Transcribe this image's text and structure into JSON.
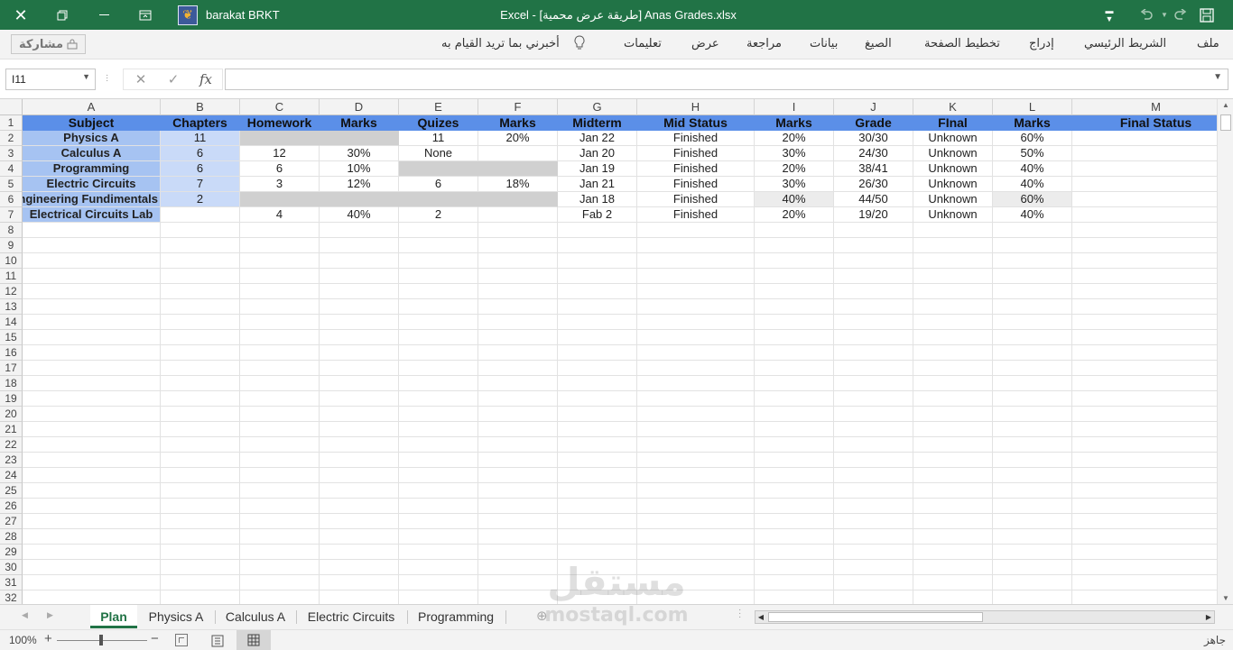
{
  "titlebar": {
    "user_name": "barakat BRKT",
    "title": "Excel  -  [طريقة عرض محمية]  Anas Grades.xlsx",
    "bg_color": "#217346"
  },
  "ribbon": {
    "share_label": "مشاركة",
    "tell_me": "أخبرني بما تريد القيام به",
    "tabs": [
      "ملف",
      "الشريط الرئيسي",
      "إدراج",
      "تخطيط الصفحة",
      "الصيغ",
      "بيانات",
      "مراجعة",
      "عرض",
      "تعليمات"
    ]
  },
  "formula_bar": {
    "name_box": "I11",
    "formula": ""
  },
  "columns": [
    "A",
    "B",
    "C",
    "D",
    "E",
    "F",
    "G",
    "H",
    "I",
    "J",
    "K",
    "L",
    "M"
  ],
  "rows_count": 32,
  "header_row": [
    "Subject",
    "Chapters",
    "Homework",
    "Marks",
    "Quizes",
    "Marks",
    "Midterm",
    "Mid Status",
    "Marks",
    "Grade",
    "FInal",
    "Marks",
    "Final Status"
  ],
  "data_rows": [
    [
      "Physics A",
      "11",
      "",
      "",
      "11",
      "20%",
      "Jan 22",
      "Finished",
      "20%",
      "30/30",
      "Unknown",
      "60%",
      ""
    ],
    [
      "Calculus A",
      "6",
      "12",
      "30%",
      "None",
      "",
      "Jan 20",
      "Finished",
      "30%",
      "24/30",
      "Unknown",
      "50%",
      ""
    ],
    [
      "Programming",
      "6",
      "6",
      "10%",
      "",
      "",
      "Jan 19",
      "Finished",
      "20%",
      "38/41",
      "Unknown",
      "40%",
      ""
    ],
    [
      "Electric Circuits",
      "7",
      "3",
      "12%",
      "6",
      "18%",
      "Jan 21",
      "Finished",
      "30%",
      "26/30",
      "Unknown",
      "40%",
      ""
    ],
    [
      "Engineering Fundimentals",
      "2",
      "",
      "",
      "",
      "",
      "Jan 18",
      "Finished",
      "40%",
      "44/50",
      "Unknown",
      "60%",
      ""
    ],
    [
      "Electrical Circuits Lab",
      "",
      "4",
      "40%",
      "2",
      "",
      "Fab 2",
      "Finished",
      "20%",
      "19/20",
      "Unknown",
      "40%",
      ""
    ]
  ],
  "sheet_tabs": [
    "Plan",
    "Physics A",
    "Calculus A",
    "Electric Circuits",
    "Programming"
  ],
  "active_sheet": "Plan",
  "status": {
    "zoom": "100%",
    "ready": "جاهز"
  },
  "watermark": {
    "arabic": "مستقل",
    "latin": "mostaql.com"
  },
  "colors": {
    "header_fill": "#5b8fe8",
    "subject_fill": "#a6c3f2",
    "chapters_fill": "#c9daf8",
    "gray_fill": "#d0d0d0",
    "accent": "#217346"
  }
}
